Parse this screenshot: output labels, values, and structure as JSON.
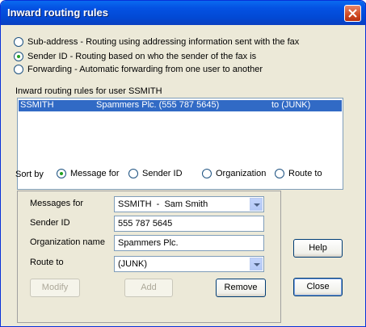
{
  "window": {
    "title": "Inward routing rules"
  },
  "routing_modes": [
    {
      "label": "Sub-address - Routing using addressing information sent with the fax",
      "selected": false
    },
    {
      "label": "Sender ID - Routing based on who the sender of the fax is",
      "selected": true
    },
    {
      "label": "Forwarding - Automatic forwarding from one user to another",
      "selected": false
    }
  ],
  "rules_list": {
    "heading": "Inward routing rules for user SSMITH",
    "rows": [
      {
        "user": "SSMITH",
        "sender": "Spammers Plc. (555 787 5645)",
        "route": "to (JUNK)",
        "selected": true
      }
    ]
  },
  "sort": {
    "label": "Sort by",
    "options": [
      {
        "label": "Message for",
        "selected": true
      },
      {
        "label": "Sender ID",
        "selected": false
      },
      {
        "label": "Organization",
        "selected": false
      },
      {
        "label": "Route to",
        "selected": false
      }
    ]
  },
  "form": {
    "messages_for_label": "Messages for",
    "messages_for_value": "SSMITH  -  Sam Smith",
    "sender_id_label": "Sender ID",
    "sender_id_value": "555 787 5645",
    "org_label": "Organization name",
    "org_value": "Spammers Plc.",
    "route_label": "Route to",
    "route_value": "(JUNK)"
  },
  "buttons": {
    "modify": "Modify",
    "add": "Add",
    "remove": "Remove",
    "help": "Help",
    "close": "Close"
  }
}
